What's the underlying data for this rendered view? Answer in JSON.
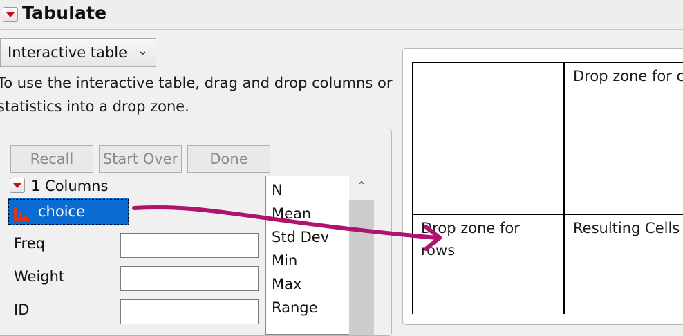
{
  "window": {
    "title": "Tabulate"
  },
  "mode_select": {
    "value": "Interactive table"
  },
  "instructions": "To use the interactive table, drag and drop columns or statistics into a drop zone.",
  "buttons": {
    "recall": "Recall",
    "start_over": "Start Over",
    "done": "Done"
  },
  "columns": {
    "header": "1 Columns",
    "items": [
      {
        "label": "choice",
        "icon": "bar-chart-icon",
        "selected": true
      }
    ]
  },
  "roles": [
    {
      "label": "Freq",
      "value": ""
    },
    {
      "label": "Weight",
      "value": ""
    },
    {
      "label": "ID",
      "value": ""
    }
  ],
  "statistics": [
    "N",
    "Mean",
    "Std Dev",
    "Min",
    "Max",
    "Range"
  ],
  "table": {
    "col_zone": "Drop zone for c",
    "row_zone": "Drop zone for rows",
    "result_cells": "Resulting Cells"
  },
  "colors": {
    "selection": "#0a6bd1",
    "arrow": "#b0136f",
    "disclosure": "#c0101a",
    "icon": "#d8371c"
  }
}
